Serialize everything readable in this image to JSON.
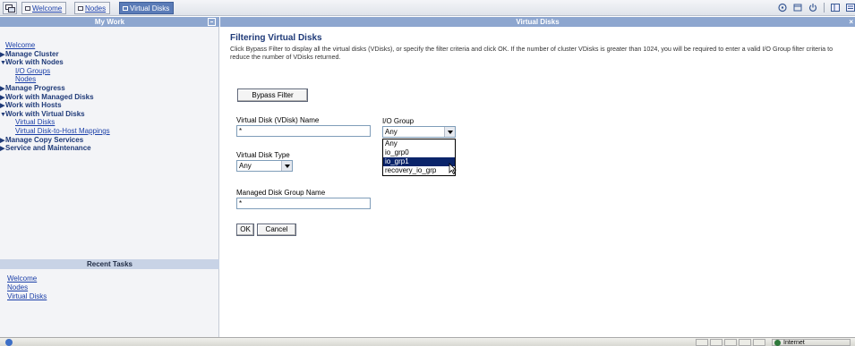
{
  "tabs": [
    {
      "label": "Welcome",
      "active": false
    },
    {
      "label": "Nodes",
      "active": false
    },
    {
      "label": "Virtual Disks",
      "active": true
    }
  ],
  "left": {
    "header": "My Work",
    "nav": [
      {
        "label": "Welcome",
        "type": "link"
      },
      {
        "label": "Manage Cluster",
        "type": "section",
        "expanded": false
      },
      {
        "label": "Work with Nodes",
        "type": "section",
        "expanded": true
      },
      {
        "label": "I/O Groups",
        "type": "sublink"
      },
      {
        "label": "Nodes",
        "type": "sublink"
      },
      {
        "label": "Manage Progress",
        "type": "section",
        "expanded": false
      },
      {
        "label": "Work with Managed Disks",
        "type": "section",
        "expanded": false
      },
      {
        "label": "Work with Hosts",
        "type": "section",
        "expanded": false
      },
      {
        "label": "Work with Virtual Disks",
        "type": "section",
        "expanded": true
      },
      {
        "label": "Virtual Disks",
        "type": "sublink"
      },
      {
        "label": "Virtual Disk-to-Host Mappings",
        "type": "sublink"
      },
      {
        "label": "Manage Copy Services",
        "type": "section",
        "expanded": false
      },
      {
        "label": "Service and Maintenance",
        "type": "section",
        "expanded": false
      }
    ],
    "recent_header": "Recent Tasks",
    "recent": [
      "Welcome",
      "Nodes",
      "Virtual Disks"
    ]
  },
  "right": {
    "header": "Virtual Disks",
    "title": "Filtering Virtual Disks",
    "description": "Click Bypass Filter to display all the virtual disks (VDisks), or specify the filter criteria and click OK. If the number of cluster VDisks is greater than 1024, you will be required to enter a valid I/O Group filter criteria to reduce the number of VDisks returned.",
    "bypass_label": "Bypass Filter",
    "vdisk_name_label": "Virtual Disk (VDisk) Name",
    "vdisk_name_value": "*",
    "io_group_label": "I/O Group",
    "io_group_value": "Any",
    "io_group_options": [
      "Any",
      "io_grp0",
      "io_grp1",
      "recovery_io_grp"
    ],
    "io_group_highlighted": "io_grp1",
    "vdisk_type_label": "Virtual Disk Type",
    "vdisk_type_value": "Any",
    "mdisk_group_label": "Managed Disk Group Name",
    "mdisk_group_value": "*",
    "ok_label": "OK",
    "cancel_label": "Cancel"
  },
  "status": {
    "zone": "Internet"
  },
  "colors": {
    "header": "#8da6cf",
    "selection": "#0a246a",
    "link": "#1b3fa8"
  }
}
